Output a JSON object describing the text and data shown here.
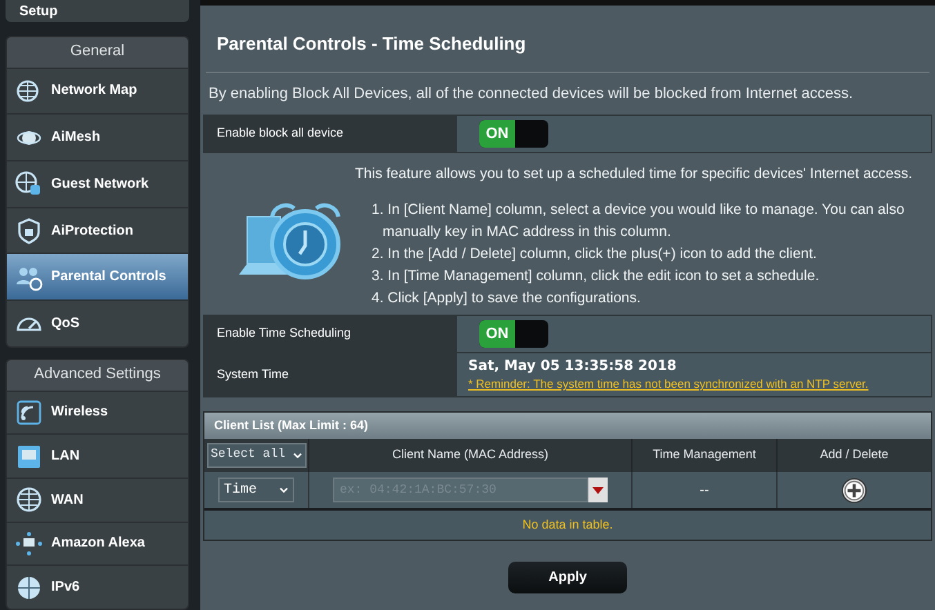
{
  "sidebar": {
    "top_item": {
      "label": "Setup"
    },
    "sections": [
      {
        "title": "General",
        "items": [
          {
            "label": "Network Map",
            "selected": false
          },
          {
            "label": "AiMesh",
            "selected": false
          },
          {
            "label": "Guest Network",
            "selected": false
          },
          {
            "label": "AiProtection",
            "selected": false
          },
          {
            "label": "Parental Controls",
            "selected": true
          },
          {
            "label": "QoS",
            "selected": false
          }
        ]
      },
      {
        "title": "Advanced Settings",
        "items": [
          {
            "label": "Wireless",
            "selected": false
          },
          {
            "label": "LAN",
            "selected": false
          },
          {
            "label": "WAN",
            "selected": false
          },
          {
            "label": "Amazon Alexa",
            "selected": false
          },
          {
            "label": "IPv6",
            "selected": false
          }
        ]
      }
    ]
  },
  "main": {
    "title": "Parental Controls - Time Scheduling",
    "description": "By enabling Block All Devices, all of the connected devices will be blocked from Internet access.",
    "block_all": {
      "label": "Enable block all device",
      "toggle": "ON",
      "on": true
    },
    "info": {
      "intro": "This feature allows you to set up a scheduled time for specific devices' Internet access.",
      "steps": [
        "1. In [Client Name] column, select a device you would like to manage. You can also manually key in MAC address in this column.",
        "2. In the [Add / Delete] column, click the plus(+) icon to add the client.",
        "3. In [Time Management] column, click the edit icon to set a schedule.",
        "4. Click [Apply] to save the configurations."
      ]
    },
    "time_scheduling": {
      "label": "Enable Time Scheduling",
      "toggle": "ON",
      "on": true
    },
    "system_time": {
      "label": "System Time",
      "value": "Sat, May 05 13:35:58 2018",
      "reminder": "* Reminder: The system time has not been synchronized with an NTP server."
    },
    "client_list": {
      "title": "Client List (Max Limit : 64)",
      "select": "Select all",
      "columns": [
        "Client Name (MAC Address)",
        "Time Management",
        "Add / Delete"
      ],
      "entry": {
        "mode": "Time",
        "placeholder": "ex: 04:42:1A:BC:57:30",
        "time_management": "--"
      },
      "empty": "No data in table."
    },
    "apply": "Apply"
  }
}
